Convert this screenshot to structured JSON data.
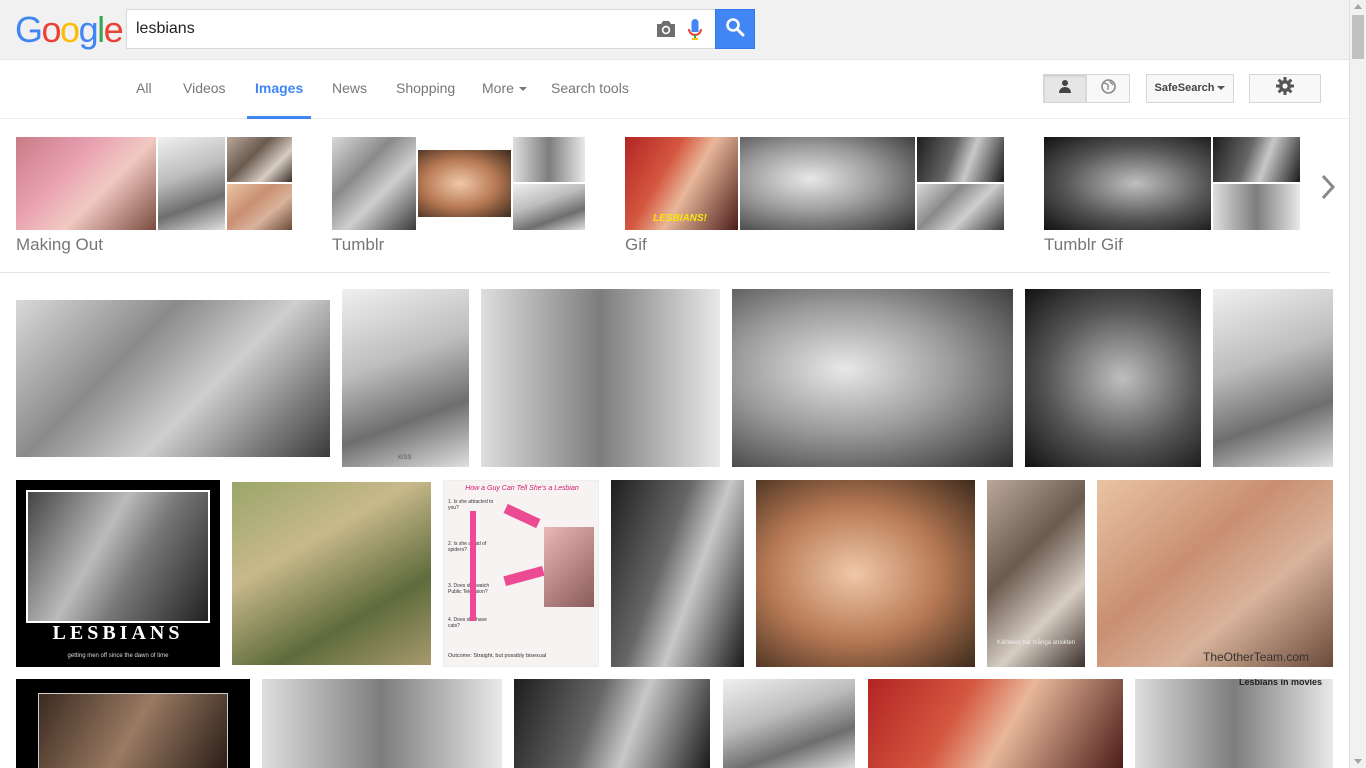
{
  "logo": {
    "letters": [
      "G",
      "o",
      "o",
      "g",
      "l",
      "e"
    ]
  },
  "search": {
    "query": "lesbians"
  },
  "tabs": [
    {
      "label": "All"
    },
    {
      "label": "Videos"
    },
    {
      "label": "Images",
      "active": true
    },
    {
      "label": "News"
    },
    {
      "label": "Shopping"
    },
    {
      "label": "More"
    },
    {
      "label": "Search tools"
    }
  ],
  "toolbar": {
    "safesearch_label": "SafeSearch"
  },
  "related": [
    {
      "label": "Making Out"
    },
    {
      "label": "Tumblr"
    },
    {
      "label": "Gif"
    },
    {
      "label": "Tumblr Gif"
    }
  ],
  "captions": {
    "gif_sign": "LESBIANS!",
    "kiss_small": "KISS",
    "poster_title": "LESBIANS",
    "poster_subtitle": "getting men off since the dawn of time",
    "infographic_title": "How a Guy Can Tell She's a Lesbian",
    "infographic_q1": "1. Is she attracted to you?",
    "infographic_q2": "2. Is she afraid of spiders?",
    "infographic_q3": "3. Does she watch Public Television?",
    "infographic_q4": "4. Does she have cats?",
    "infographic_outcome": "Outcome: Straight, but possibly bisexual",
    "swedish_caption": "Kärleken har många ansikten",
    "watermark": "TheOtherTeam.com",
    "movies_caption": "Lesbians in movies"
  },
  "colors": {
    "accent": "#4285f4",
    "tab_text": "#777777",
    "topbar_bg": "#f1f1f1"
  },
  "icons": {
    "camera": "camera-icon",
    "mic": "microphone-icon",
    "search": "search-icon",
    "person": "person-icon",
    "globe": "globe-icon",
    "gear": "gear-icon",
    "next": "chevron-right-icon"
  }
}
